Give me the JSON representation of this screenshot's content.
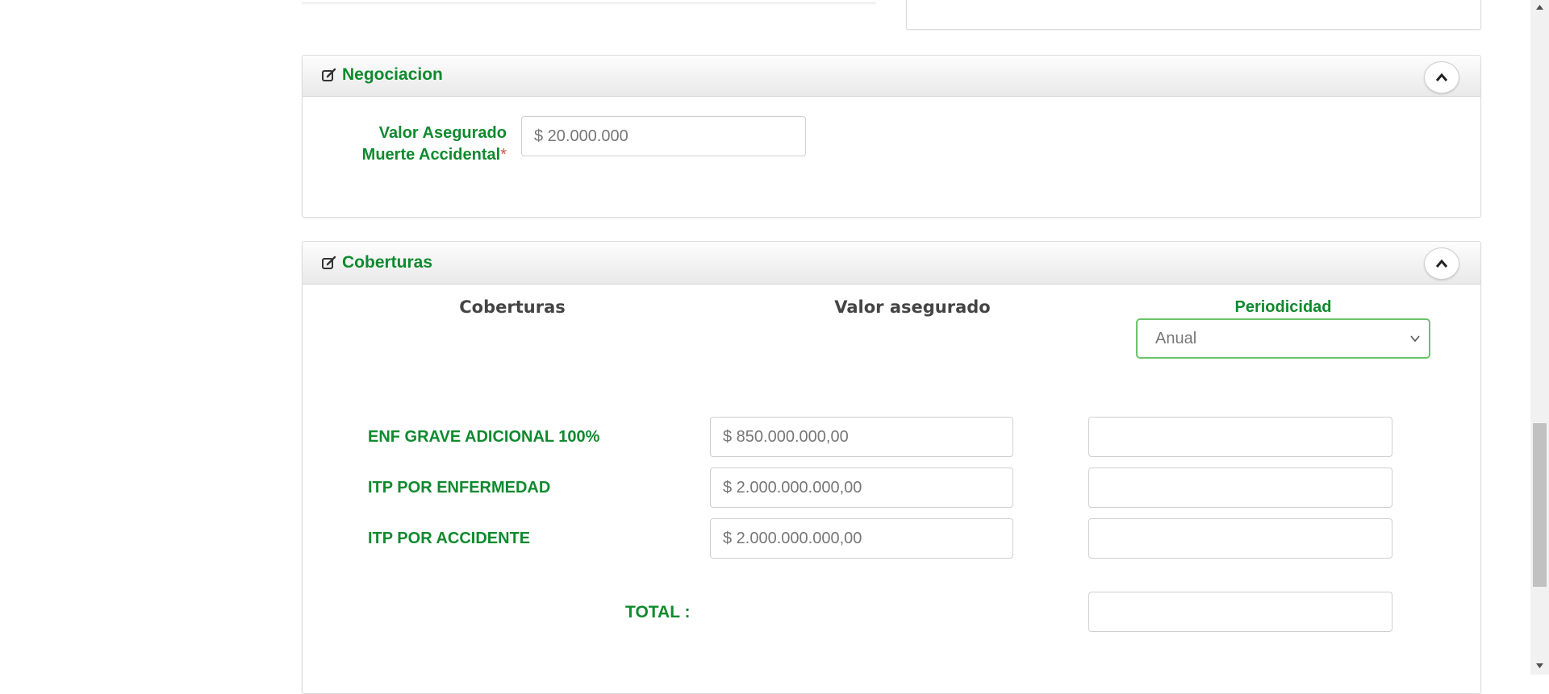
{
  "negociacion": {
    "title": "Negociacion",
    "valor_label_line1": "Valor Asegurado",
    "valor_label_line2": "Muerte Accidental",
    "required_mark": "*",
    "valor_value": "$ 20.000.000"
  },
  "coberturas": {
    "title": "Coberturas",
    "col_coberturas": "Coberturas",
    "col_valor": "Valor asegurado",
    "col_periodicidad": "Periodicidad",
    "periodicidad_selected": "Anual",
    "rows": [
      {
        "label": "ENF GRAVE ADICIONAL 100%",
        "valor": "$ 850.000.000,00",
        "periodicidad": ""
      },
      {
        "label": "ITP POR ENFERMEDAD",
        "valor": "$ 2.000.000.000,00",
        "periodicidad": ""
      },
      {
        "label": "ITP POR ACCIDENTE",
        "valor": "$ 2.000.000.000,00",
        "periodicidad": ""
      }
    ],
    "total_label": "TOTAL :",
    "total_value": ""
  },
  "colors": {
    "accent_green": "#0f8a2e",
    "select_border": "#6bc36b",
    "required_red": "#d9534f"
  },
  "icons": {
    "panel_icon": "edit-icon",
    "collapse": "chevron-up-icon",
    "select": "chevron-down-icon"
  }
}
